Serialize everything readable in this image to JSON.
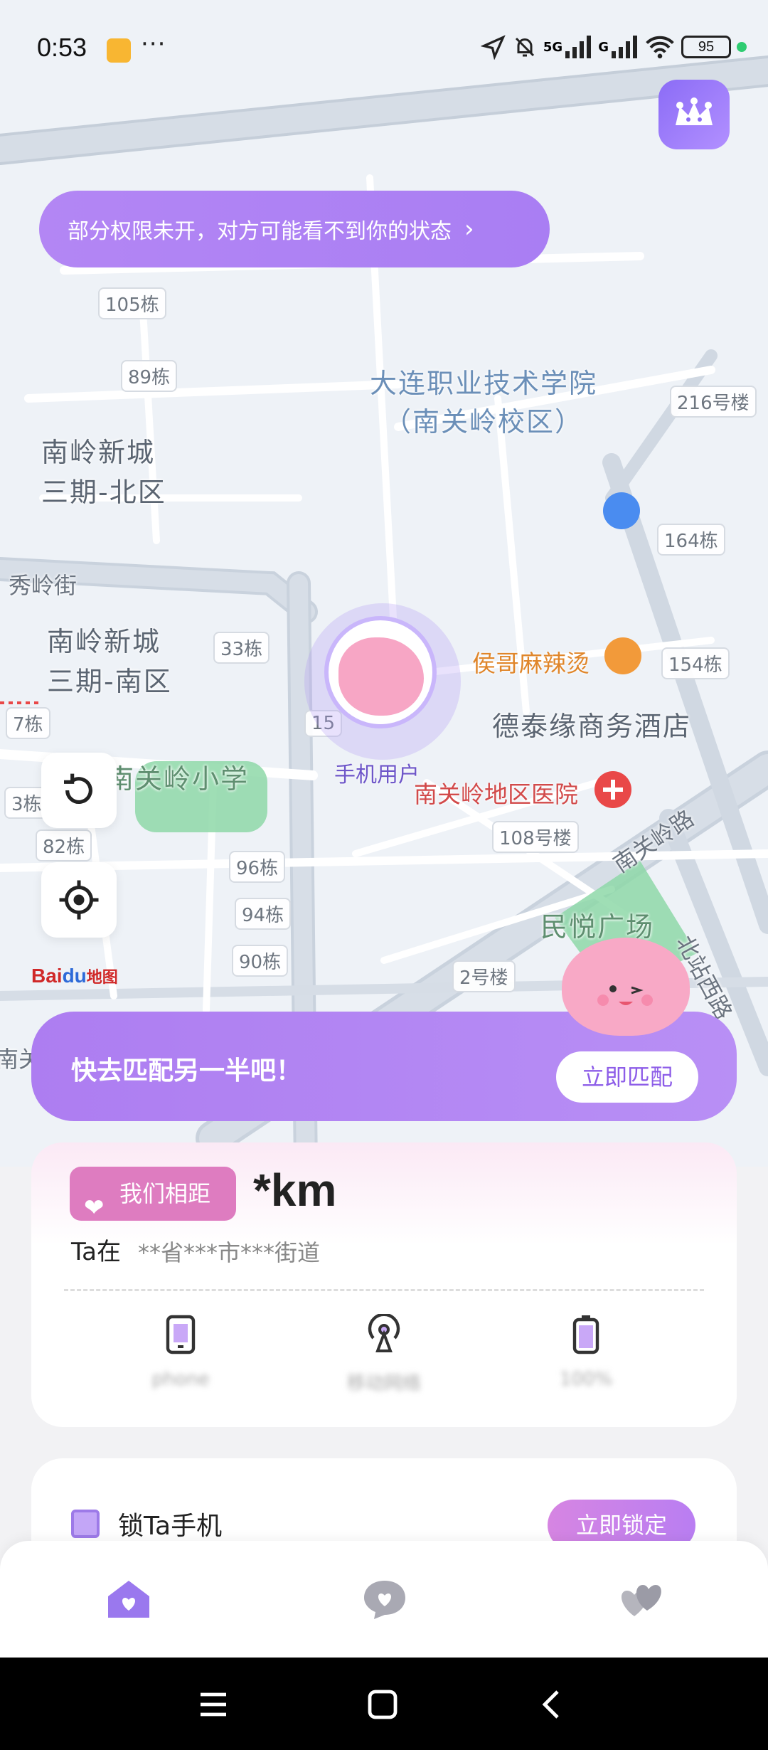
{
  "status_bar": {
    "time": "0:53",
    "dots": "···",
    "network1": "5G",
    "network2": "G",
    "battery": "95"
  },
  "permission_banner": {
    "text": "部分权限未开，对方可能看不到你的状态",
    "chevron": "›"
  },
  "map": {
    "labels": {
      "b105": "105栋",
      "b89": "89栋",
      "campus_line1": "大连职业技术学院",
      "campus_line2": "（南关岭校区）",
      "b216": "216号楼",
      "nlxc_north_1": "南岭新城",
      "nlxc_north_2": "三期-北区",
      "b164": "164栋",
      "xiuling": "秀岭街",
      "nlxc_south_1": "南岭新城",
      "nlxc_south_2": "三期-南区",
      "b33": "33栋",
      "b154": "154栋",
      "houge": "侯哥麻辣烫",
      "detai": "德泰缘商务酒店",
      "b7": "7栋",
      "b15": "15",
      "school": "南关岭小学",
      "hospital": "南关岭地区医院",
      "b3": "3栋",
      "b108": "108号楼",
      "b82": "82栋",
      "nanguanling_road": "南关岭路",
      "b96": "96栋",
      "b94": "94栋",
      "minyue": "民悦广场",
      "b90": "90栋",
      "beizhan": "北站西路",
      "b2": "2号楼",
      "nan": "南关"
    },
    "user_marker_label": "手机用户",
    "logo_text_1": "Bai",
    "logo_text_2": "du",
    "logo_text_3": "地图"
  },
  "match_card": {
    "text": "快去匹配另一半吧！",
    "button": "立即匹配"
  },
  "distance_card": {
    "badge": "我们相距",
    "distance": "*km",
    "ta_label": "Ta在",
    "location": "**省***市***街道",
    "stats": [
      {
        "icon": "phone-icon",
        "value": "phone"
      },
      {
        "icon": "signal-icon",
        "value": "移动网络"
      },
      {
        "icon": "battery-icon",
        "value": "100%"
      }
    ]
  },
  "lock_card": {
    "text": "锁Ta手机",
    "button": "立即锁定"
  },
  "colors": {
    "primary": "#a97ef3",
    "pink": "#de7cc0"
  }
}
